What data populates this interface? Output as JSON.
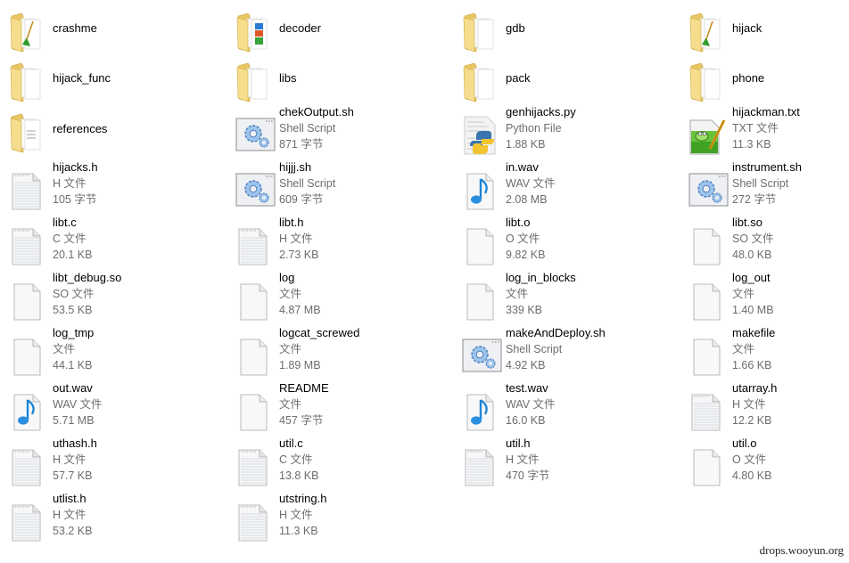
{
  "window": {
    "view": "Tiles"
  },
  "items": [
    {
      "name": "crashme",
      "kind": "folder",
      "icon": "folder-with-pencil-icon"
    },
    {
      "name": "decoder",
      "kind": "folder",
      "icon": "folder-with-archive-icon"
    },
    {
      "name": "gdb",
      "kind": "folder",
      "icon": "folder-icon"
    },
    {
      "name": "hijack",
      "kind": "folder",
      "icon": "folder-with-pencil-icon"
    },
    {
      "name": "hijack_func",
      "kind": "folder",
      "icon": "folder-icon"
    },
    {
      "name": "libs",
      "kind": "folder",
      "icon": "folder-icon"
    },
    {
      "name": "pack",
      "kind": "folder",
      "icon": "folder-icon"
    },
    {
      "name": "phone",
      "kind": "folder",
      "icon": "folder-icon"
    },
    {
      "name": "references",
      "kind": "folder",
      "icon": "folder-with-documents-icon"
    },
    {
      "name": "chekOutput.sh",
      "kind": "file",
      "type": "Shell Script",
      "size": "871 字节",
      "icon": "shell-script-icon"
    },
    {
      "name": "genhijacks.py",
      "kind": "file",
      "type": "Python File",
      "size": "1.88 KB",
      "icon": "python-file-icon"
    },
    {
      "name": "hijackman.txt",
      "kind": "file",
      "type": "TXT 文件",
      "size": "11.3 KB",
      "icon": "notepad-plus-plus-text-icon"
    },
    {
      "name": "hijacks.h",
      "kind": "file",
      "type": "H 文件",
      "size": "105 字节",
      "icon": "text-document-icon"
    },
    {
      "name": "hijjj.sh",
      "kind": "file",
      "type": "Shell Script",
      "size": "609 字节",
      "icon": "shell-script-icon"
    },
    {
      "name": "in.wav",
      "kind": "file",
      "type": "WAV 文件",
      "size": "2.08 MB",
      "icon": "audio-file-icon"
    },
    {
      "name": "instrument.sh",
      "kind": "file",
      "type": "Shell Script",
      "size": "272 字节",
      "icon": "shell-script-icon"
    },
    {
      "name": "libt.c",
      "kind": "file",
      "type": "C 文件",
      "size": "20.1 KB",
      "icon": "text-document-icon"
    },
    {
      "name": "libt.h",
      "kind": "file",
      "type": "H 文件",
      "size": "2.73 KB",
      "icon": "text-document-icon"
    },
    {
      "name": "libt.o",
      "kind": "file",
      "type": "O 文件",
      "size": "9.82 KB",
      "icon": "blank-file-icon"
    },
    {
      "name": "libt.so",
      "kind": "file",
      "type": "SO 文件",
      "size": "48.0 KB",
      "icon": "blank-file-icon"
    },
    {
      "name": "libt_debug.so",
      "kind": "file",
      "type": "SO 文件",
      "size": "53.5 KB",
      "icon": "blank-file-icon"
    },
    {
      "name": "log",
      "kind": "file",
      "type": "文件",
      "size": "4.87 MB",
      "icon": "blank-file-icon"
    },
    {
      "name": "log_in_blocks",
      "kind": "file",
      "type": "文件",
      "size": "339 KB",
      "icon": "blank-file-icon"
    },
    {
      "name": "log_out",
      "kind": "file",
      "type": "文件",
      "size": "1.40 MB",
      "icon": "blank-file-icon"
    },
    {
      "name": "log_tmp",
      "kind": "file",
      "type": "文件",
      "size": "44.1 KB",
      "icon": "blank-file-icon"
    },
    {
      "name": "logcat_screwed",
      "kind": "file",
      "type": "文件",
      "size": "1.89 MB",
      "icon": "blank-file-icon"
    },
    {
      "name": "makeAndDeploy.sh",
      "kind": "file",
      "type": "Shell Script",
      "size": "4.92 KB",
      "icon": "shell-script-icon"
    },
    {
      "name": "makefile",
      "kind": "file",
      "type": "文件",
      "size": "1.66 KB",
      "icon": "blank-file-icon"
    },
    {
      "name": "out.wav",
      "kind": "file",
      "type": "WAV 文件",
      "size": "5.71 MB",
      "icon": "audio-file-icon"
    },
    {
      "name": "README",
      "kind": "file",
      "type": "文件",
      "size": "457 字节",
      "icon": "blank-file-icon"
    },
    {
      "name": "test.wav",
      "kind": "file",
      "type": "WAV 文件",
      "size": "16.0 KB",
      "icon": "audio-file-icon"
    },
    {
      "name": "utarray.h",
      "kind": "file",
      "type": "H 文件",
      "size": "12.2 KB",
      "icon": "text-document-icon"
    },
    {
      "name": "uthash.h",
      "kind": "file",
      "type": "H 文件",
      "size": "57.7 KB",
      "icon": "text-document-icon"
    },
    {
      "name": "util.c",
      "kind": "file",
      "type": "C 文件",
      "size": "13.8 KB",
      "icon": "text-document-icon"
    },
    {
      "name": "util.h",
      "kind": "file",
      "type": "H 文件",
      "size": "470 字节",
      "icon": "text-document-icon"
    },
    {
      "name": "util.o",
      "kind": "file",
      "type": "O 文件",
      "size": "4.80 KB",
      "icon": "blank-file-icon"
    },
    {
      "name": "utlist.h",
      "kind": "file",
      "type": "H 文件",
      "size": "53.2 KB",
      "icon": "text-document-icon"
    },
    {
      "name": "utstring.h",
      "kind": "file",
      "type": "H 文件",
      "size": "11.3 KB",
      "icon": "text-document-icon"
    }
  ],
  "watermark": "drops.wooyun.org"
}
